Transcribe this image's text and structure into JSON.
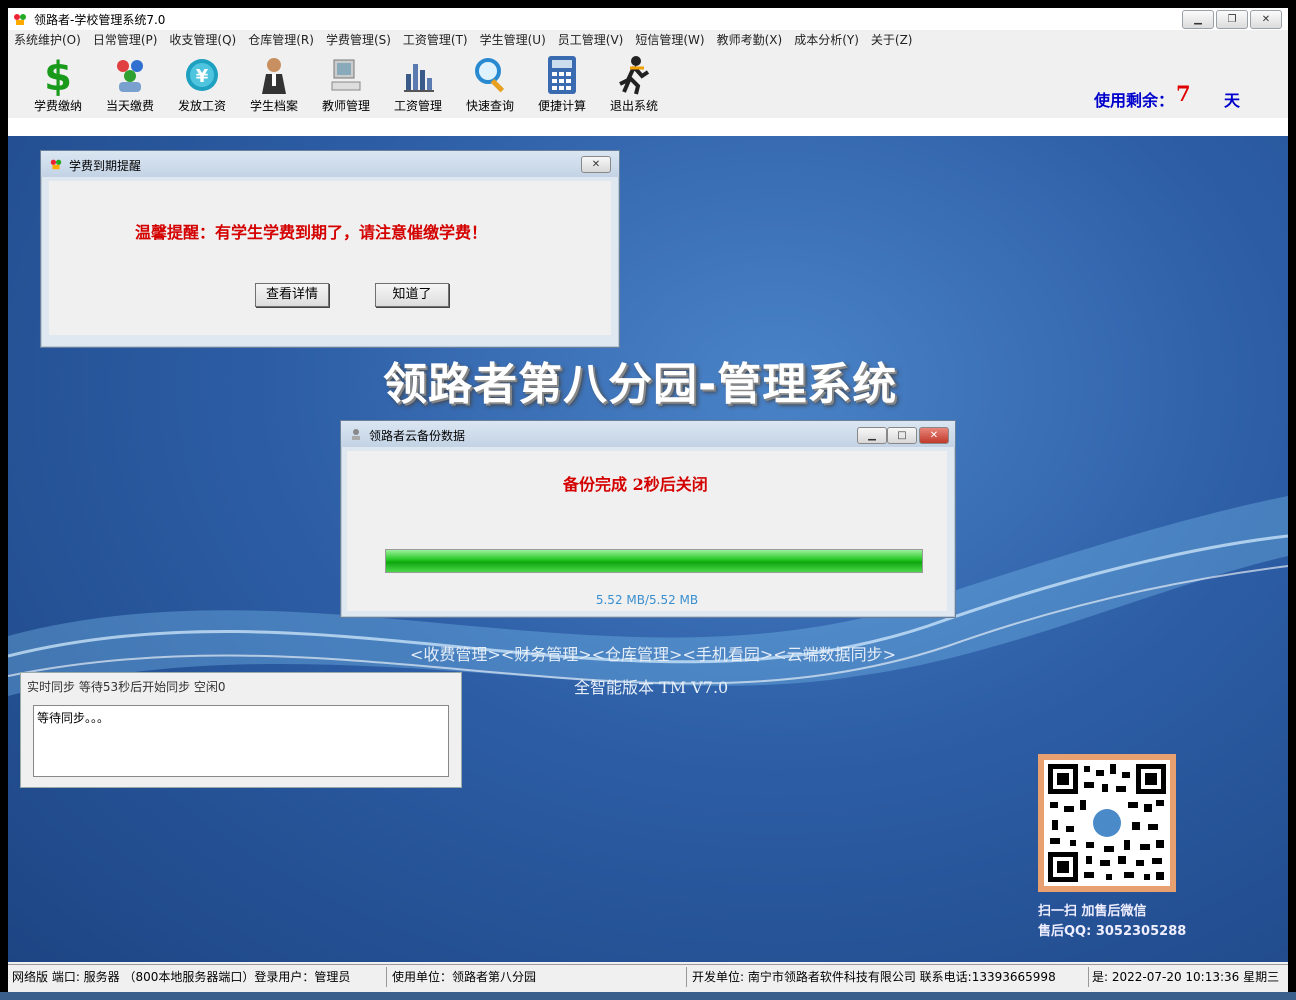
{
  "window": {
    "title": "领路者-学校管理系统7.0",
    "min": "▁",
    "max": "❐",
    "close": "✕"
  },
  "menu": [
    "系统维护(O)",
    "日常管理(P)",
    "收支管理(Q)",
    "仓库管理(R)",
    "学费管理(S)",
    "工资管理(T)",
    "学生管理(U)",
    "员工管理(V)",
    "短信管理(W)",
    "教师考勤(X)",
    "成本分析(Y)",
    "关于(Z)"
  ],
  "toolbar": [
    {
      "label": "学费缴纳",
      "icon": "dollar-icon"
    },
    {
      "label": "当天缴费",
      "icon": "people-icon"
    },
    {
      "label": "发放工资",
      "icon": "yen-coin-icon"
    },
    {
      "label": "学生档案",
      "icon": "student-icon"
    },
    {
      "label": "教师管理",
      "icon": "computer-icon"
    },
    {
      "label": "工资管理",
      "icon": "bar-chart-icon"
    },
    {
      "label": "快速查询",
      "icon": "magnifier-icon"
    },
    {
      "label": "便捷计算",
      "icon": "calculator-icon"
    },
    {
      "label": "退出系统",
      "icon": "running-man-icon"
    }
  ],
  "usage": {
    "label": "使用剩余：",
    "days": "7",
    "unit": "天"
  },
  "desktop": {
    "title": "领路者第八分园-管理系统",
    "modules": "<收费管理><财务管理><仓库管理><手机看园><云端数据同步>",
    "edition": "全智能版本 TM V7.0",
    "qr_caption1": "扫一扫 加售后微信",
    "qr_caption2": "售后QQ: 3052305288"
  },
  "reminder": {
    "title": "学费到期提醒",
    "message": "温馨提醒：有学生学费到期了，请注意催缴学费！",
    "detail_button": "查看详情",
    "ok_button": "知道了",
    "close": "✕"
  },
  "backup": {
    "title": "领路者云备份数据",
    "status": "备份完成 2秒后关闭",
    "size": "5.52 MB/5.52 MB",
    "progress": 1.0,
    "min": "▁",
    "max": "□",
    "close": "✕"
  },
  "sync": {
    "status": "实时同步 等待53秒后开始同步 空闲0",
    "log": "等待同步。。。"
  },
  "statusbar": {
    "left": "网络版 端口: 服务器 （800本地服务器端口）登录用户：管理员",
    "unit": "使用单位：领路者第八分园",
    "dev": "开发单位: 南宁市领路者软件科技有限公司 联系电话:13393665998",
    "time": "是: 2022-07-20 10:13:36 星期三"
  },
  "colors": {
    "accent_red": "#d40000",
    "usage_blue": "#0000cc",
    "progress_green": "#22c722",
    "desktop_blue": "#2d5ea6"
  }
}
